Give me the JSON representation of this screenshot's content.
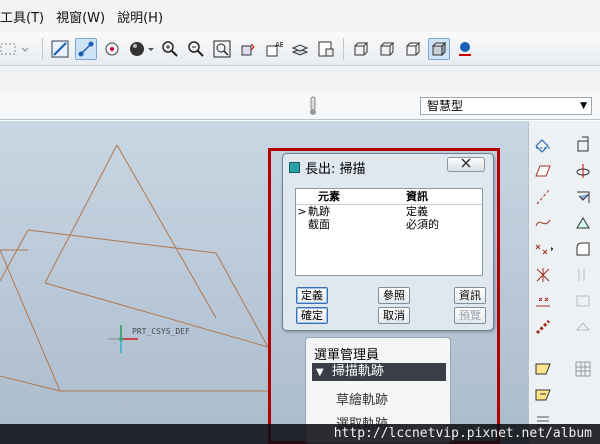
{
  "menu_bar": {
    "items": [
      "工具(T)",
      "視窗(W)",
      "說明(H)"
    ]
  },
  "toolbar": {
    "icons": [
      "select-box-icon",
      "sketch-icon",
      "datum-display-icon",
      "spin-center-icon",
      "sphere-shade-icon",
      "zoom-in-icon",
      "zoom-out-icon",
      "refit-icon",
      "orient-icon",
      "named-view-icon",
      "layers-icon",
      "model-tree-icon",
      "wireframe-icon",
      "hidden-line-icon",
      "no-hidden-icon",
      "shading-icon",
      "appearance-icon"
    ]
  },
  "filter": {
    "selected": "智慧型"
  },
  "model": {
    "csys_label": "PRT_CSYS_DEF"
  },
  "dialog": {
    "title": "長出: 掃描",
    "close_label": "",
    "table": {
      "headers": [
        "元素",
        "資訊"
      ],
      "rows": [
        {
          "marker": ">",
          "element": "軌跡",
          "info": "定義"
        },
        {
          "marker": "",
          "element": "截面",
          "info": "必須的"
        }
      ]
    },
    "buttons": {
      "define": "定義",
      "refs": "參照",
      "info": "資訊",
      "ok": "確定",
      "cancel": "取消",
      "preview": "預覽"
    }
  },
  "menu_manager": {
    "title": "選單管理員",
    "header": "掃描軌跡",
    "items": [
      "草繪軌跡",
      "選取軌跡"
    ]
  },
  "watermark": "http://lccnetvip.pixnet.net/album",
  "colors": {
    "highlight_border": "#b00000",
    "viewport": "#bccad9",
    "geometry": "#b07850"
  }
}
